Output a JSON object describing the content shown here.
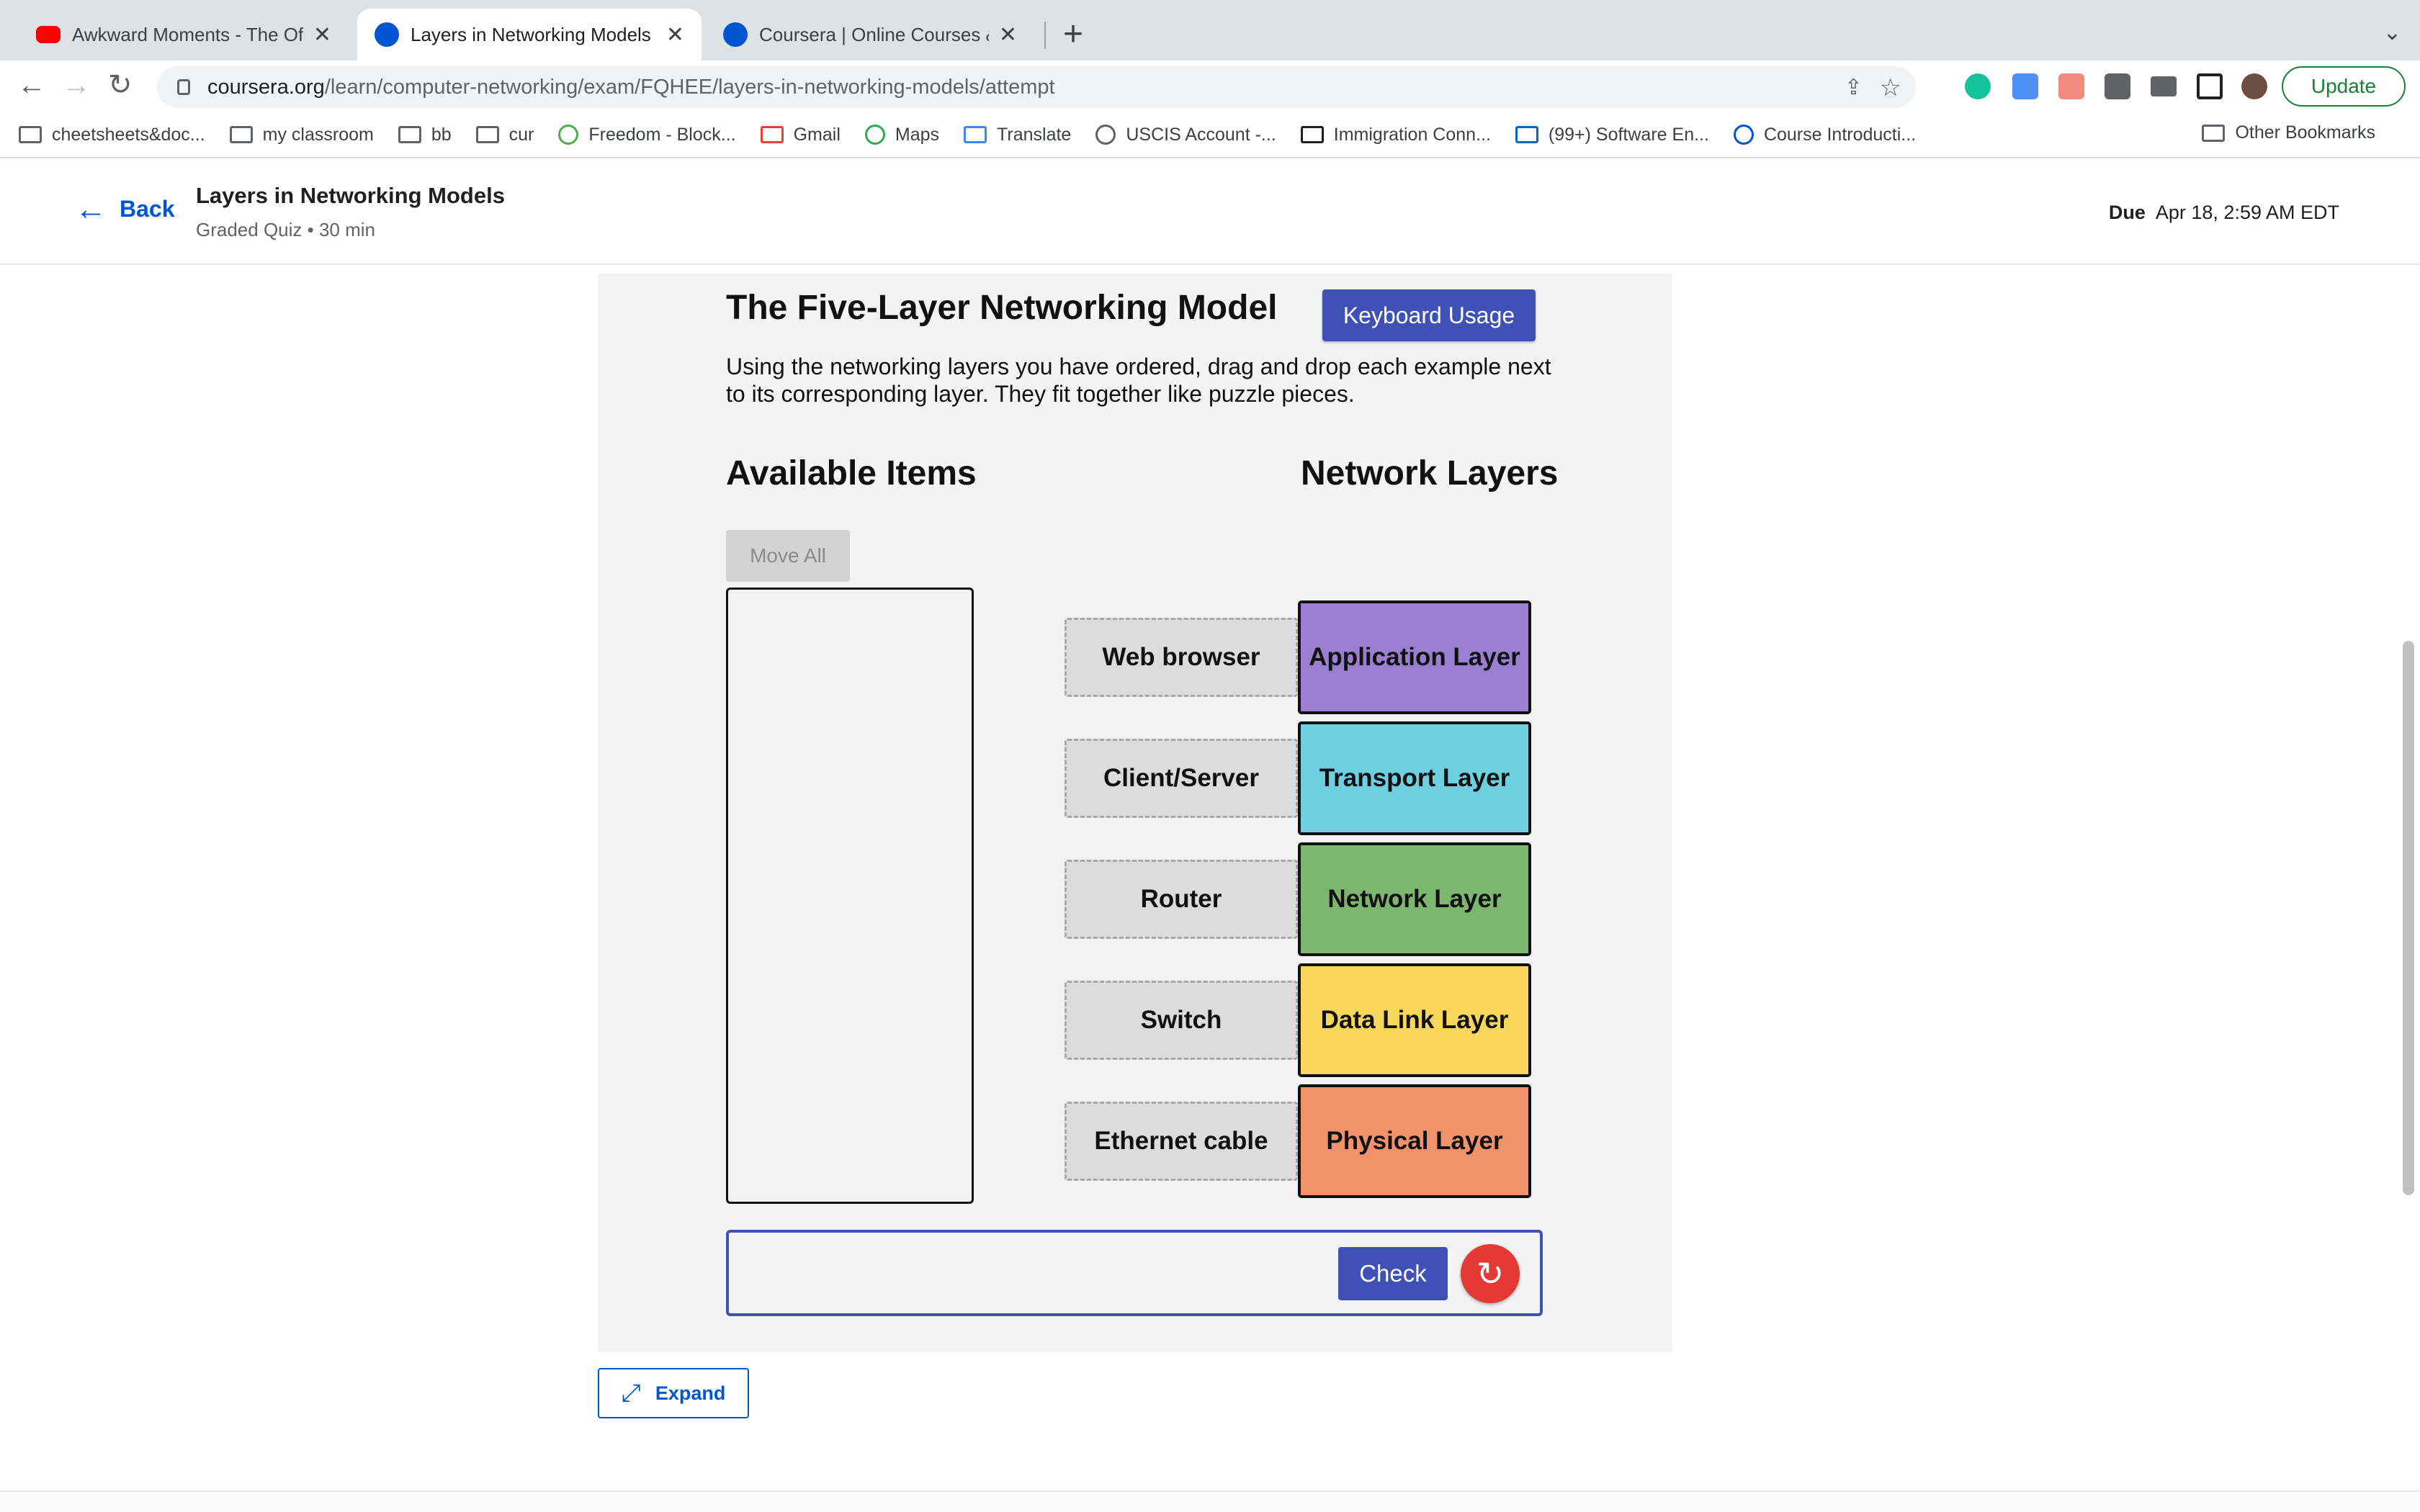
{
  "browser": {
    "tabs": [
      {
        "title": "Awkward Moments - The Offic",
        "favicon": "youtube-icon"
      },
      {
        "title": "Layers in Networking Models |",
        "favicon": "coursera-icon"
      },
      {
        "title": "Coursera | Online Courses & Cr",
        "favicon": "coursera-icon"
      }
    ],
    "new_tab": "+",
    "url_host": "coursera.org",
    "url_path": "/learn/computer-networking/exam/FQHEE/layers-in-networking-models/attempt",
    "update_label": "Update",
    "bookmarks": [
      "cheetsheets&doc...",
      "my classroom",
      "bb",
      "cur",
      "Freedom - Block...",
      "Gmail",
      "Maps",
      "Translate",
      "USCIS Account -...",
      "Immigration Conn...",
      "(99+) Software En...",
      "Course Introducti..."
    ],
    "other_bookmarks": "Other Bookmarks"
  },
  "header": {
    "back_label": "Back",
    "title": "Layers in Networking Models",
    "subtitle": "Graded Quiz • 30 min",
    "due_label": "Due",
    "due_value": "Apr 18, 2:59 AM EDT"
  },
  "activity": {
    "title": "The Five-Layer Networking Model",
    "keyboard_button": "Keyboard Usage",
    "instructions": "Using the networking layers you have ordered, drag and drop each example next to its corresponding layer. They fit together like puzzle pieces.",
    "available_heading": "Available Items",
    "layers_heading": "Network Layers",
    "move_all": "Move All",
    "rows": [
      {
        "example": "Web browser",
        "layer": "Application Layer",
        "color": "#9a7fd1"
      },
      {
        "example": "Client/Server",
        "layer": "Transport Layer",
        "color": "#6ecfe0"
      },
      {
        "example": "Router",
        "layer": "Network Layer",
        "color": "#7cb66f"
      },
      {
        "example": "Switch",
        "layer": "Data Link Layer",
        "color": "#f7d65a"
      },
      {
        "example": "Ethernet cable",
        "layer": "Physical Layer",
        "color": "#f0926c"
      }
    ],
    "check_button": "Check",
    "reset_icon": "↻"
  },
  "expand_label": "Expand"
}
